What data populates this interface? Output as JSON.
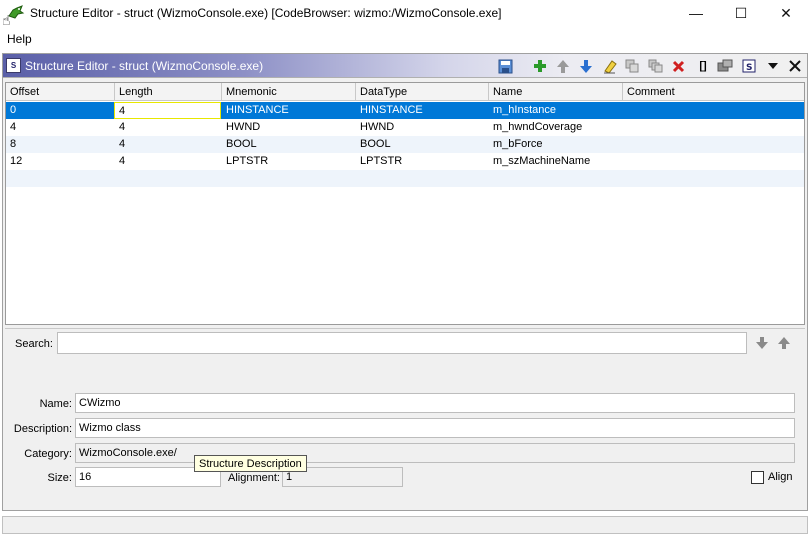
{
  "window": {
    "title": "Structure Editor - struct (WizmoConsole.exe) [CodeBrowser: wizmo:/WizmoConsole.exe]",
    "minimize": "—",
    "maximize": "☐",
    "close": "✕"
  },
  "menu": {
    "help": "Help"
  },
  "pane": {
    "icon_text": "S",
    "title": "Structure Editor - struct (WizmoConsole.exe)"
  },
  "toolbar": {
    "icons": [
      "save-icon",
      "add-icon",
      "move-up-icon",
      "move-down-icon",
      "clear-icon",
      "duplicate-icon",
      "duplicate-multiple-icon",
      "delete-icon",
      "array-icon",
      "unpackage-icon",
      "structure-icon",
      "dropdown-icon",
      "close-icon"
    ],
    "array_label": "[]"
  },
  "table": {
    "columns": [
      "Offset",
      "Length",
      "Mnemonic",
      "DataType",
      "Name",
      "Comment"
    ],
    "rows": [
      {
        "offset": "0",
        "length": "4",
        "mnemonic": "HINSTANCE",
        "datatype": "HINSTANCE",
        "name": "m_hInstance",
        "comment": ""
      },
      {
        "offset": "4",
        "length": "4",
        "mnemonic": "HWND",
        "datatype": "HWND",
        "name": "m_hwndCoverage",
        "comment": ""
      },
      {
        "offset": "8",
        "length": "4",
        "mnemonic": "BOOL",
        "datatype": "BOOL",
        "name": "m_bForce",
        "comment": ""
      },
      {
        "offset": "12",
        "length": "4",
        "mnemonic": "LPTSTR",
        "datatype": "LPTSTR",
        "name": "m_szMachineName",
        "comment": ""
      }
    ]
  },
  "search": {
    "label": "Search:",
    "value": ""
  },
  "form": {
    "name_label": "Name:",
    "name_value": "CWizmo",
    "description_label": "Description:",
    "description_value": "Wizmo class",
    "category_label": "Category:",
    "category_value": "WizmoConsole.exe/",
    "size_label": "Size:",
    "size_value": "16",
    "alignment_label": "Alignment:",
    "alignment_value": "1",
    "align_label": "Align",
    "tooltip": "Structure Description"
  },
  "colors": {
    "selection": "#0078d7",
    "header_gradient_start": "#5a5fa8",
    "add_green": "#2a9a2a",
    "delete_red": "#d02020",
    "arrow_blue": "#2a6fd0"
  }
}
